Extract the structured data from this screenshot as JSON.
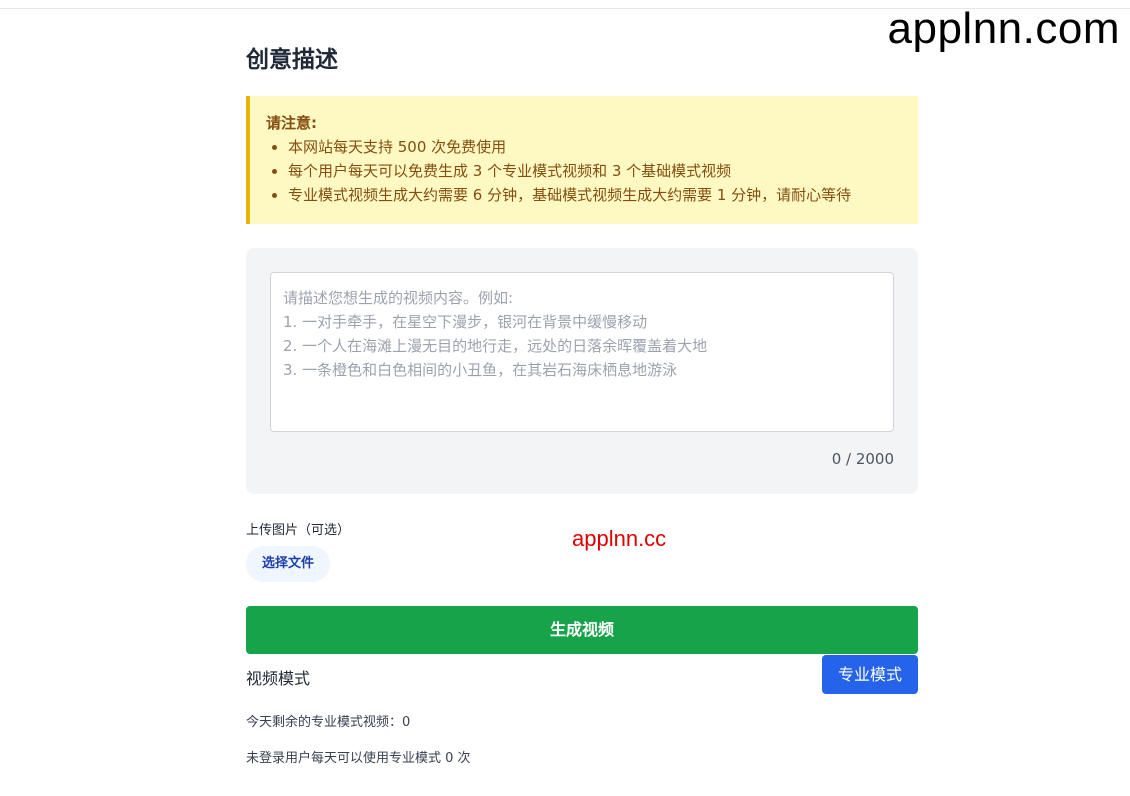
{
  "watermarks": {
    "top": "applnn.com",
    "middle": "applnn.cc"
  },
  "page": {
    "title": "创意描述"
  },
  "notice": {
    "title": "请注意:",
    "items": [
      "本网站每天支持 500 次免费使用",
      "每个用户每天可以免费生成 3 个专业模式视频和 3 个基础模式视频",
      "专业模式视频生成大约需要 6 分钟，基础模式视频生成大约需要 1 分钟，请耐心等待"
    ]
  },
  "prompt": {
    "placeholder": "请描述您想生成的视频内容。例如:\n1. 一对手牵手，在星空下漫步，银河在背景中缓慢移动\n2. 一个人在海滩上漫无目的地行走，远处的日落余晖覆盖着大地\n3. 一条橙色和白色相间的小丑鱼，在其岩石海床栖息地游泳",
    "value": "",
    "char_count": "0 / 2000"
  },
  "upload": {
    "label": "上传图片（可选）",
    "button_label": "选择文件"
  },
  "actions": {
    "generate_label": "生成视频"
  },
  "mode": {
    "label": "视频模式",
    "selected": "专业模式"
  },
  "status": {
    "remaining_pro": "今天剩余的专业模式视频：0",
    "guest_limit": "未登录用户每天可以使用专业模式 0 次"
  },
  "colors": {
    "notice_bg": "#fef9c3",
    "notice_border": "#eab308",
    "generate_button": "#16a34a",
    "mode_button": "#2563eb"
  }
}
